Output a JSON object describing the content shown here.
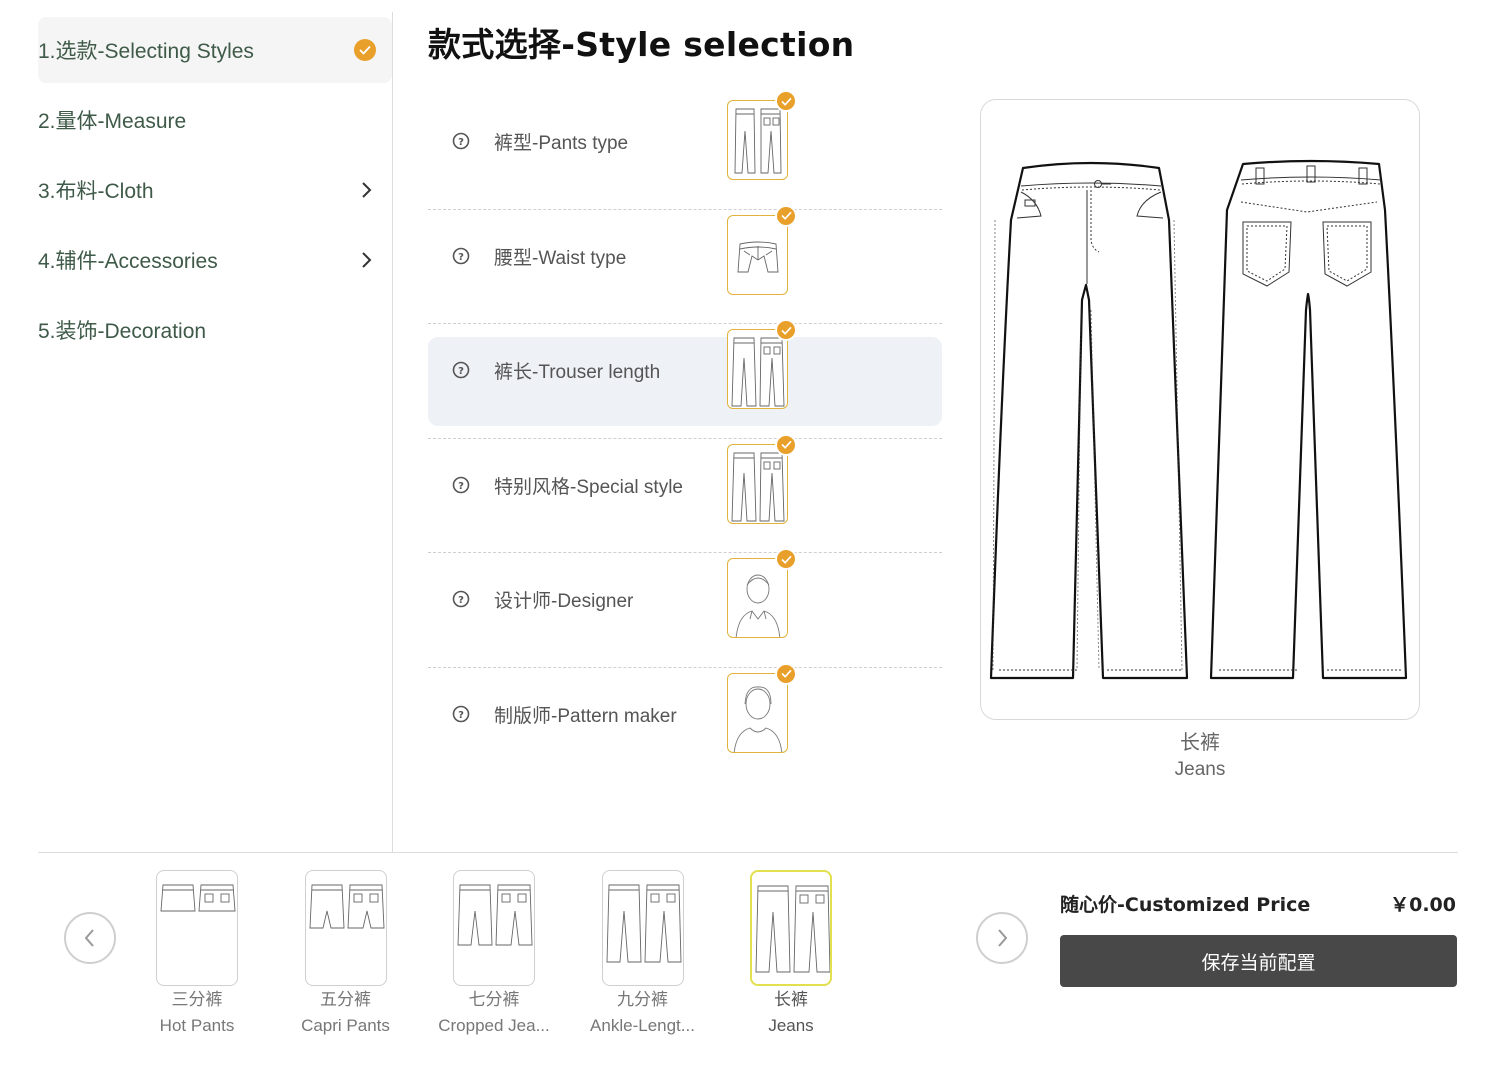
{
  "sidebar": {
    "items": [
      {
        "label": "1.选款-Selecting Styles",
        "state": "completed"
      },
      {
        "label": "2.量体-Measure"
      },
      {
        "label": "3.布料-Cloth",
        "icon": "chevron-right-icon"
      },
      {
        "label": "4.辅件-Accessories",
        "icon": "chevron-right-icon"
      },
      {
        "label": "5.装饰-Decoration"
      }
    ]
  },
  "page_title": "款式选择-Style selection",
  "options": [
    {
      "label": "裤型-Pants type",
      "thumb": "pants-type-thumbnail"
    },
    {
      "label": "腰型-Waist type",
      "thumb": "waist-type-thumbnail"
    },
    {
      "label": "裤长-Trouser length",
      "thumb": "trouser-length-thumbnail"
    },
    {
      "label": "特别风格-Special style",
      "thumb": "special-style-thumbnail"
    },
    {
      "label": "设计师-Designer",
      "thumb": "designer-avatar"
    },
    {
      "label": "制版师-Pattern maker",
      "thumb": "pattern-maker-avatar"
    }
  ],
  "preview": {
    "name_zh": "长裤",
    "name_en": "Jeans"
  },
  "carousel": {
    "items": [
      {
        "zh": "三分裤",
        "en": "Hot Pants",
        "length": 0.3
      },
      {
        "zh": "五分裤",
        "en": "Capri Pants",
        "length": 0.5
      },
      {
        "zh": "七分裤",
        "en": "Cropped Jea...",
        "length": 0.7
      },
      {
        "zh": "九分裤",
        "en": "Ankle-Lengt...",
        "length": 0.9
      },
      {
        "zh": "长裤",
        "en": "Jeans",
        "length": 1.0
      }
    ],
    "selected_index": 4,
    "prev_icon": "chevron-left-icon",
    "next_icon": "chevron-right-icon"
  },
  "price": {
    "label": "随心价-Customized Price",
    "value": "￥0.00"
  },
  "save_button": "保存当前配置",
  "colors": {
    "accent": "#e9a02b",
    "sidebar_text": "#3f5a48",
    "button": "#484848",
    "selected_border": "#e2e04e"
  }
}
